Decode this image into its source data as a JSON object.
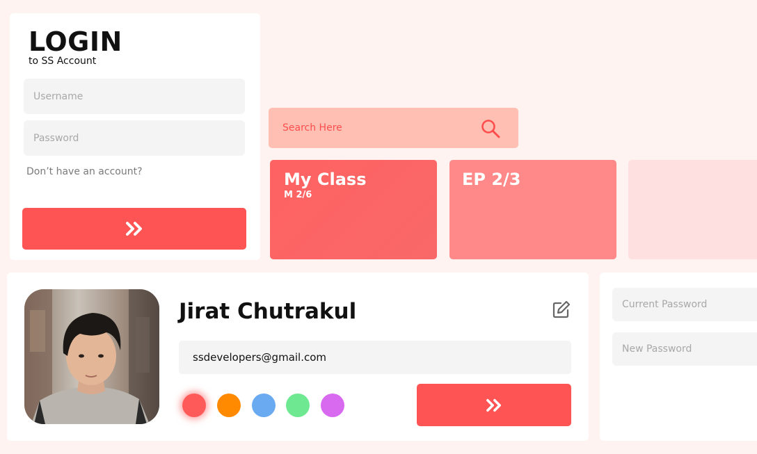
{
  "login": {
    "title": "LOGIN",
    "subtitle": "to SS Account",
    "username_placeholder": "Username",
    "password_placeholder": "Password",
    "signup_link": "Don’t have an account?",
    "submit_icon": "double-chevron-right-icon"
  },
  "search": {
    "placeholder": "Search Here",
    "icon": "search-icon"
  },
  "tiles": [
    {
      "title": "My Class",
      "subtitle": "M 2/6"
    },
    {
      "title": "EP 2/3",
      "subtitle": ""
    },
    {
      "title": "",
      "subtitle": ""
    }
  ],
  "profile": {
    "name": "Jirat Chutrakul",
    "email": "ssdevelopers@gmail.com",
    "edit_icon": "edit-icon",
    "submit_icon": "double-chevron-right-icon",
    "theme_colors": [
      "#ff5a5a",
      "#ff8a00",
      "#6aaaf0",
      "#6fe892",
      "#d86af0"
    ],
    "selected_color_index": 0
  },
  "password": {
    "current_placeholder": "Current Password",
    "new_placeholder": "New Password"
  },
  "colors": {
    "background": "#fff3f1",
    "accent": "#ff5454",
    "search_bg": "#ffc0b3",
    "tile_1": "#ff6262",
    "tile_2": "#ff8888",
    "tile_3": "#ffe0e0"
  }
}
